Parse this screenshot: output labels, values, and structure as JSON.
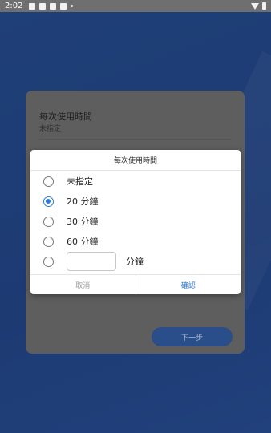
{
  "status_bar": {
    "time": "2:02"
  },
  "page": {
    "setting_title": "每次使用時間",
    "setting_value": "未指定",
    "next_button": "下一步"
  },
  "dialog": {
    "title": "每次使用時間",
    "options": [
      {
        "label": "未指定",
        "selected": false
      },
      {
        "label": "20 分鐘",
        "selected": true
      },
      {
        "label": "30 分鐘",
        "selected": false
      },
      {
        "label": "60 分鐘",
        "selected": false
      }
    ],
    "custom_value": "",
    "custom_unit": "分鐘",
    "cancel_label": "取消",
    "confirm_label": "確認"
  },
  "colors": {
    "accent": "#2e7cd6",
    "background": "#1f3f78",
    "scrim_card": "#5e5e5e"
  }
}
